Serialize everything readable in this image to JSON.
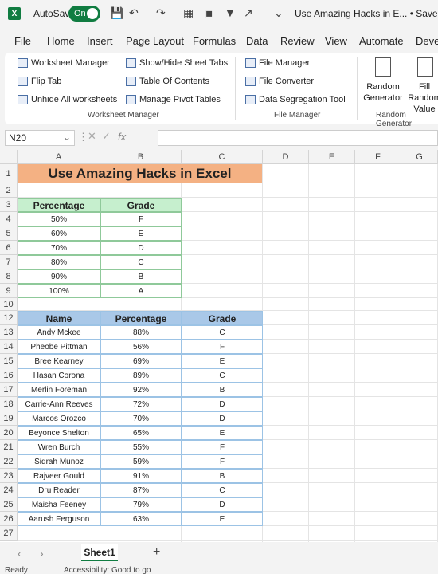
{
  "titlebar": {
    "app_icon": "X",
    "autosave_label": "AutoSave",
    "autosave_state": "On",
    "doc_title": "Use Amazing Hacks in E... • Saved ∨"
  },
  "menu": [
    "File",
    "Home",
    "Insert",
    "Page Layout",
    "Formulas",
    "Data",
    "Review",
    "View",
    "Automate",
    "Deve"
  ],
  "ribbon": {
    "worksheet_manager": [
      "Worksheet Manager",
      "Flip Tab",
      "Unhide All worksheets"
    ],
    "sheet_tools": [
      "Show/Hide Sheet Tabs",
      "Table Of Contents",
      "Manage Pivot Tables"
    ],
    "file_tools": [
      "File Manager",
      "File Converter",
      "Data Segregation Tool"
    ],
    "random_generator": "Random Generator",
    "fill_random": "Fill Random Value",
    "groups": [
      "Worksheet Manager",
      "File Manager",
      "Random Generator"
    ]
  },
  "formula_bar": {
    "name_box": "N20",
    "fx": "fx",
    "value": ""
  },
  "columns": [
    "A",
    "B",
    "C",
    "D",
    "E",
    "F",
    "G"
  ],
  "rows": [
    1,
    2,
    3,
    4,
    5,
    6,
    7,
    8,
    9,
    10,
    12,
    13,
    14,
    15,
    16,
    17,
    18,
    19,
    20,
    21,
    22,
    23,
    24,
    25,
    26,
    27
  ],
  "sheet_title": "Use Amazing Hacks in Excel",
  "grade_table": {
    "headers": [
      "Percentage",
      "Grade"
    ],
    "rows": [
      [
        "50%",
        "F"
      ],
      [
        "60%",
        "E"
      ],
      [
        "70%",
        "D"
      ],
      [
        "80%",
        "C"
      ],
      [
        "90%",
        "B"
      ],
      [
        "100%",
        "A"
      ]
    ]
  },
  "student_table": {
    "headers": [
      "Name",
      "Percentage",
      "Grade"
    ],
    "rows": [
      [
        "Andy Mckee",
        "88%",
        "C"
      ],
      [
        "Pheobe Pittman",
        "56%",
        "F"
      ],
      [
        "Bree Kearney",
        "69%",
        "E"
      ],
      [
        "Hasan Corona",
        "89%",
        "C"
      ],
      [
        "Merlin Foreman",
        "92%",
        "B"
      ],
      [
        "Carrie-Ann Reeves",
        "72%",
        "D"
      ],
      [
        "Marcos Orozco",
        "70%",
        "D"
      ],
      [
        "Beyonce Shelton",
        "65%",
        "E"
      ],
      [
        "Wren Burch",
        "55%",
        "F"
      ],
      [
        "Sidrah Munoz",
        "59%",
        "F"
      ],
      [
        "Rajveer Gould",
        "91%",
        "B"
      ],
      [
        "Dru Reader",
        "87%",
        "C"
      ],
      [
        "Maisha Feeney",
        "79%",
        "D"
      ],
      [
        "Aarush Ferguson",
        "63%",
        "E"
      ]
    ]
  },
  "sheet_tab": "Sheet1",
  "status": {
    "ready": "Ready",
    "accessibility": "Accessibility: Good to go"
  }
}
